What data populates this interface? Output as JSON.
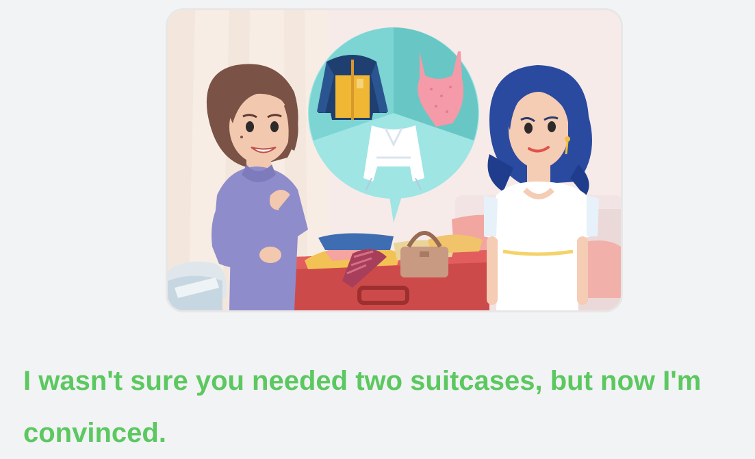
{
  "lesson": {
    "caption": "I wasn't sure you needed two suitcases, but now I'm convinced.",
    "accent_color": "#5cc860"
  },
  "illustration": {
    "items": [
      "woman-in-purple-sweater",
      "woman-in-white-dress",
      "open-red-suitcase",
      "thought-bubble",
      "jacket-icon",
      "swimsuit-icon",
      "blouse-icon"
    ]
  }
}
